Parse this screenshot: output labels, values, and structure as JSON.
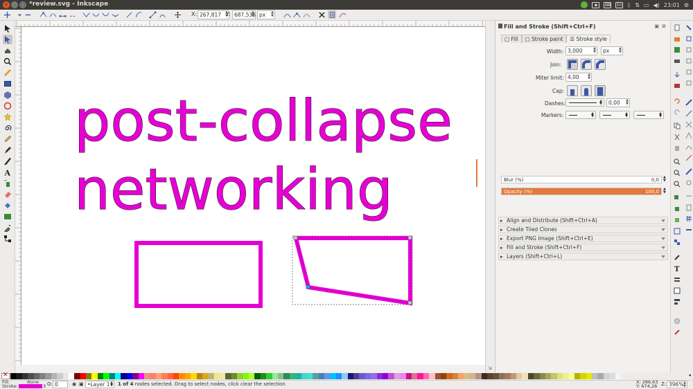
{
  "window": {
    "title": "*review.svg - Inkscape"
  },
  "tray": {
    "lang": "En",
    "time": "23:01"
  },
  "ctrl": {
    "x_label": "X:",
    "x_value": "267,817",
    "y_label": "Y:",
    "y_value": "687,535",
    "unit": "px"
  },
  "canvas": {
    "line1": "post-collapse",
    "line2": "networking",
    "text_color": "#e600d4"
  },
  "dock": {
    "title": "Fill and Stroke (Shift+Ctrl+F)",
    "tabs": [
      "Fill",
      "Stroke paint",
      "Stroke style"
    ],
    "width_label": "Width:",
    "width_value": "3,000",
    "width_unit": "px",
    "join_label": "Join:",
    "miter_label": "Miter limit:",
    "miter_value": "4,00",
    "cap_label": "Cap:",
    "dashes_label": "Dashes:",
    "dashes_value": "0,00",
    "markers_label": "Markers:",
    "blur_label": "Blur (%)",
    "blur_value": "0,0",
    "opacity_label": "Opacity (%)",
    "opacity_value": "100,0",
    "opacity_fill": 1.0,
    "panels": [
      "Align and Distribute (Shift+Ctrl+A)",
      "Create Tiled Clones",
      "Export PNG Image (Shift+Ctrl+E)",
      "Fill and Stroke (Shift+Ctrl+F)",
      "Layers (Shift+Ctrl+L)"
    ]
  },
  "status": {
    "fill_label": "Fill:",
    "fill_value": "None",
    "stroke_label": "Stroke:",
    "stroke_width": "3",
    "opacity_label": "O:",
    "opacity_value": "0",
    "layer": "•Layer 1",
    "message_bold": "1 of 4",
    "message": " nodes selected. Drag to select nodes, click clear the selection",
    "cursor_x": "X: 286,63",
    "cursor_y": "Y: 674,28",
    "zoom_label": "Z:",
    "zoom_value": "396%"
  },
  "colors": {
    "accent": "#e600d4",
    "opacity_bar": "#e4783a"
  }
}
